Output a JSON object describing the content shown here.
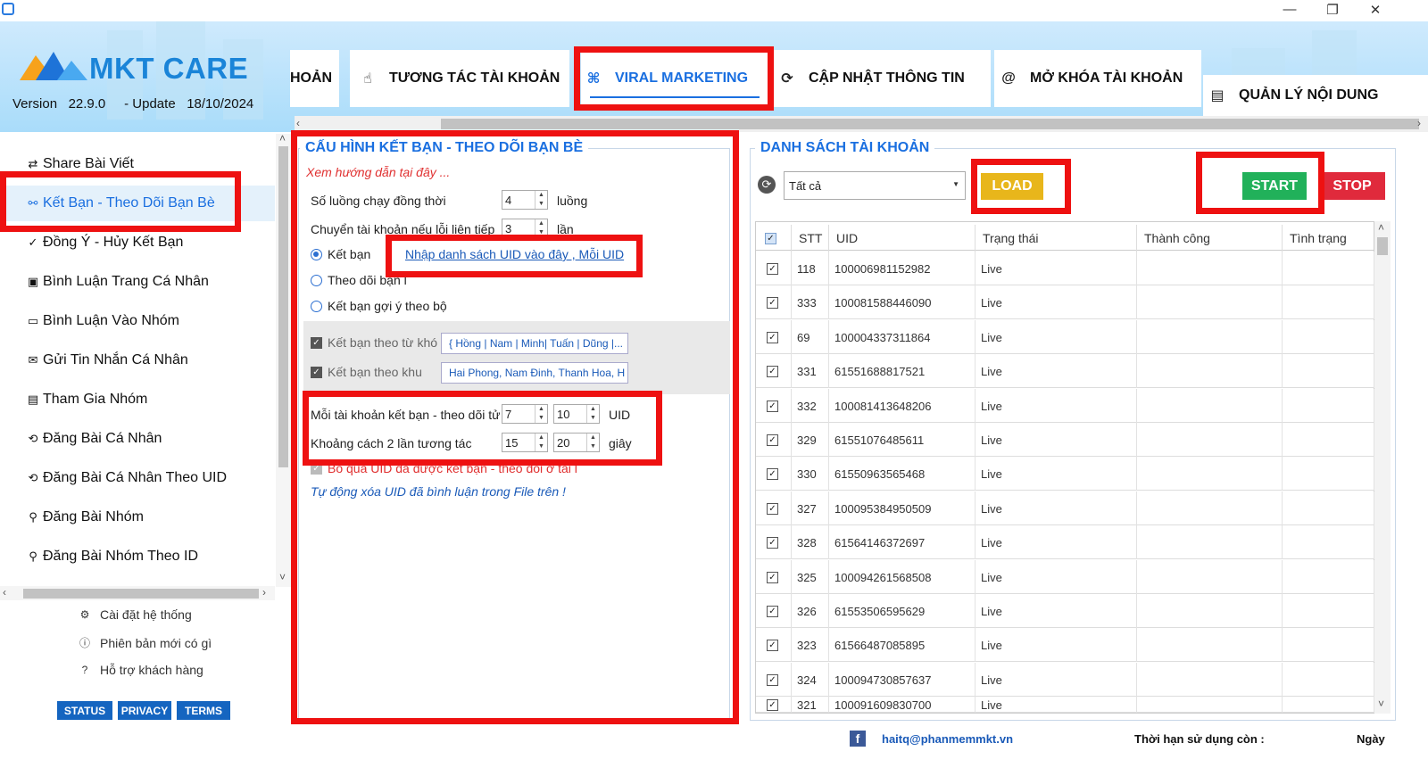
{
  "window": {
    "minimize": "—",
    "maximize": "❐",
    "close": "✕"
  },
  "brand": {
    "name": "MKT CARE",
    "version_label": "Version",
    "version": "22.9.0",
    "update_label": "- Update",
    "update_date": "18/10/2024"
  },
  "tabs": [
    {
      "label": "HOẢN",
      "icon": ""
    },
    {
      "label": "TƯƠNG TÁC TÀI KHOẢN",
      "icon": "☝"
    },
    {
      "label": "VIRAL MARKETING",
      "icon": "⌘"
    },
    {
      "label": "CẬP NHẬT THÔNG TIN",
      "icon": "⟳"
    },
    {
      "label": "MỞ KHÓA TÀI KHOẢN",
      "icon": "@"
    },
    {
      "label": "QUẢN LÝ NỘI DUNG",
      "icon": "▤"
    }
  ],
  "sidebar": {
    "items": [
      {
        "label": "Share Bài Viết",
        "icon": "⇄"
      },
      {
        "label": "Kết Bạn - Theo Dõi Bạn Bè",
        "icon": "⚯"
      },
      {
        "label": "Đồng Ý - Hủy Kết Bạn",
        "icon": "✓"
      },
      {
        "label": "Bình Luận Trang Cá Nhân",
        "icon": "▣"
      },
      {
        "label": "Bình Luận Vào Nhóm",
        "icon": "▭"
      },
      {
        "label": "Gửi Tin Nhắn Cá Nhân",
        "icon": "✉"
      },
      {
        "label": "Tham Gia Nhóm",
        "icon": "▤"
      },
      {
        "label": "Đăng Bài Cá Nhân",
        "icon": "⟲"
      },
      {
        "label": "Đăng Bài Cá Nhân Theo UID",
        "icon": "⟲"
      },
      {
        "label": "Đăng Bài Nhóm",
        "icon": "⚲"
      },
      {
        "label": "Đăng Bài Nhóm Theo ID",
        "icon": "⚲"
      }
    ],
    "footer_links": [
      {
        "label": "Cài đặt hệ thống",
        "icon": "⚙"
      },
      {
        "label": "Phiên bản mới có gì",
        "icon": "ⓘ"
      },
      {
        "label": "Hỗ trợ khách hàng",
        "icon": "?"
      }
    ],
    "footer_buttons": {
      "status": "STATUS",
      "privacy": "PRIVACY",
      "terms": "TERMS"
    }
  },
  "config": {
    "title": "CẤU HÌNH KẾT BẠN - THEO DÕI BẠN BÈ",
    "guide_link": "Xem hướng dẫn tại đây ...",
    "threads_label": "Số luồng chạy đồng thời",
    "threads_value": "4",
    "threads_unit": "luồng",
    "switch_label": "Chuyển tài khoản nếu lỗi liên tiếp",
    "switch_value": "3",
    "switch_unit": "lần",
    "radio_addfriend": "Kết bạn",
    "radio_follow": "Theo dõi bạn l",
    "radio_suggest": "Kết bạn gợi ý theo bộ",
    "uid_link": "Nhập danh sách UID vào đây , Mỗi UID",
    "kw_label": "Kết bạn theo từ khó",
    "kw_value": "{ Hồng | Nam | Minh| Tuấn | Dũng |...",
    "area_label": "Kết bạn theo khu",
    "area_value": "Hai Phong, Nam Đinh, Thanh Hoa, H",
    "per_account_label": "Mỗi tài khoản kết bạn - theo dõi tử",
    "per_account_min": "7",
    "per_account_max": "10",
    "per_account_unit": "UID",
    "interval_label": "Khoảng cách 2 lần tương tác",
    "interval_min": "15",
    "interval_max": "20",
    "interval_unit": "giây",
    "skip_label": "Bỏ qua UID đã được kết bạn - theo dõi ở tài l",
    "auto_delete": "Tự động xóa UID đã bình luận trong File trên !"
  },
  "accounts": {
    "title": "DANH SÁCH TÀI KHOẢN",
    "filter": "Tất cả",
    "load": "LOAD",
    "start": "START",
    "stop": "STOP",
    "columns": [
      "STT",
      "UID",
      "Trạng thái",
      "Thành công",
      "Tình trạng"
    ],
    "rows": [
      {
        "stt": "118",
        "uid": "100006981152982",
        "status": "Live"
      },
      {
        "stt": "333",
        "uid": "100081588446090",
        "status": "Live"
      },
      {
        "stt": "69",
        "uid": "100004337311864",
        "status": "Live"
      },
      {
        "stt": "331",
        "uid": "61551688817521",
        "status": "Live"
      },
      {
        "stt": "332",
        "uid": "100081413648206",
        "status": "Live"
      },
      {
        "stt": "329",
        "uid": "61551076485611",
        "status": "Live"
      },
      {
        "stt": "330",
        "uid": "61550963565468",
        "status": "Live"
      },
      {
        "stt": "327",
        "uid": "100095384950509",
        "status": "Live"
      },
      {
        "stt": "328",
        "uid": "61564146372697",
        "status": "Live"
      },
      {
        "stt": "325",
        "uid": "100094261568508",
        "status": "Live"
      },
      {
        "stt": "326",
        "uid": "61553506595629",
        "status": "Live"
      },
      {
        "stt": "323",
        "uid": "61566487085895",
        "status": "Live"
      },
      {
        "stt": "324",
        "uid": "100094730857637",
        "status": "Live"
      },
      {
        "stt": "321",
        "uid": "100091609830700",
        "status": "Live"
      }
    ]
  },
  "statusbar": {
    "email": "haitq@phanmemmkt.vn",
    "expiry_label": "Thời hạn sử dụng còn :",
    "expiry_unit": "Ngày"
  },
  "colors": {
    "accent": "#1a6fe0",
    "highlight": "#ee1111",
    "load": "#e8b61b",
    "start": "#21b15a",
    "stop": "#e02a3c"
  }
}
